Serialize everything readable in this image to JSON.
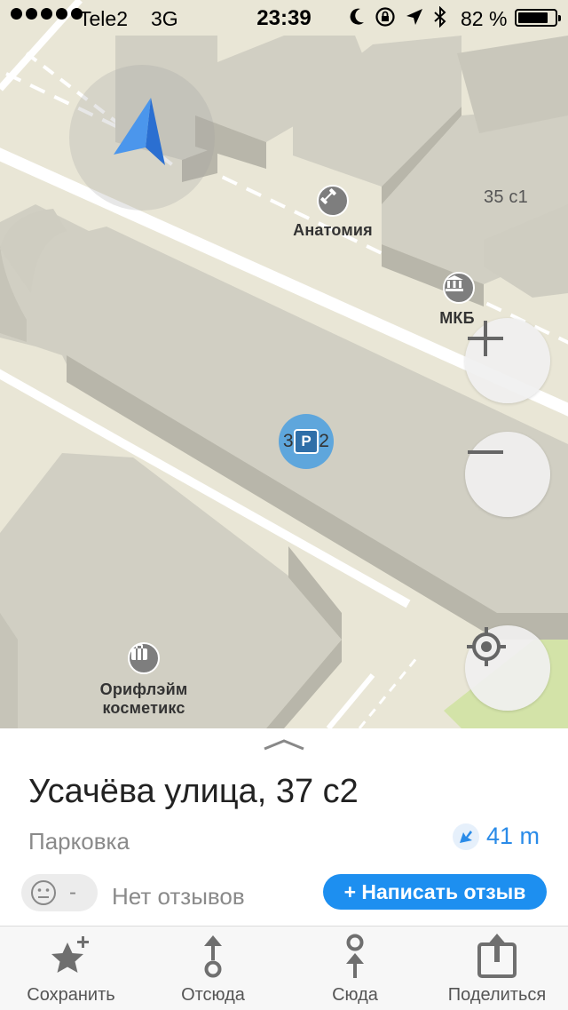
{
  "status_bar": {
    "carrier": "Tele2",
    "network": "3G",
    "time": "23:39",
    "battery_percent": "82 %",
    "battery_level": 0.82,
    "signal_dots": 5
  },
  "map": {
    "labels": {
      "anatomy": "Анатомия",
      "building_35": "35 с1",
      "mkb": "МКБ",
      "building_37": "37 с2",
      "oriflame_line1": "Орифлэйм",
      "oriflame_line2": "косметикс"
    },
    "parking_symbol": "P",
    "icons": {
      "location_arrow": "navigation-arrow-icon",
      "fitness": "dumbbell-icon",
      "bank": "bank-icon",
      "shop": "briefcase-icon",
      "zoom_in": "plus-icon",
      "zoom_out": "minus-icon",
      "locate": "crosshair-icon"
    }
  },
  "place": {
    "title": "Усачёва улица, 37 с2",
    "category": "Парковка",
    "distance": "41 m",
    "rating_value": "-",
    "reviews_text": "Нет отзывов",
    "write_review_label": "+ Написать отзыв"
  },
  "tabs": [
    {
      "label": "Сохранить",
      "icon": "star-plus-icon"
    },
    {
      "label": "Отсюда",
      "icon": "route-from-icon"
    },
    {
      "label": "Сюда",
      "icon": "route-to-icon"
    },
    {
      "label": "Поделиться",
      "icon": "share-icon"
    }
  ],
  "colors": {
    "accent": "#1d8ff0",
    "distance_text": "#2a8be8",
    "map_ground": "#e9e6d6",
    "building_top": "#d1cfc3",
    "building_side": "#b8b6aa",
    "park": "#d3e3a8",
    "parking_marker": "#4a9fe0"
  }
}
